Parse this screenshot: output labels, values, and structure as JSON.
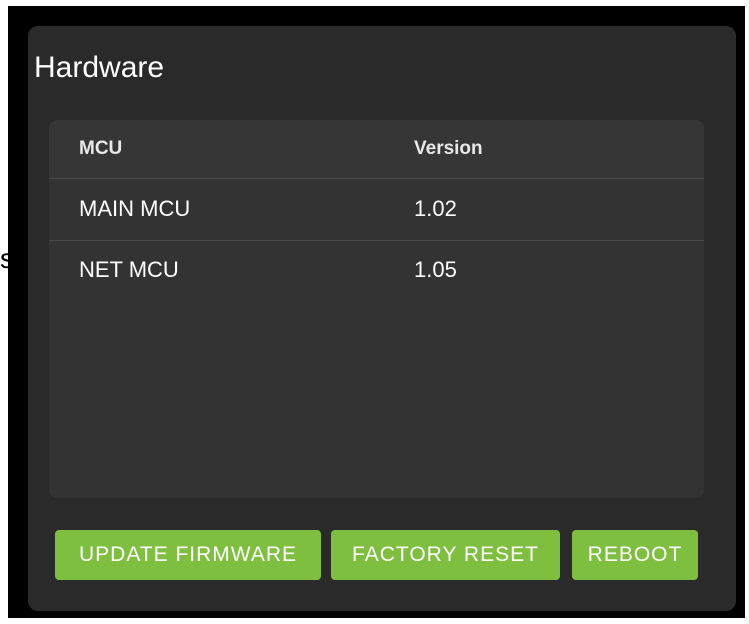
{
  "stray_text": "s",
  "card": {
    "title": "Hardware"
  },
  "table": {
    "columns": [
      "MCU",
      "Version"
    ],
    "rows": [
      [
        "MAIN MCU",
        "1.02"
      ],
      [
        "NET MCU",
        "1.05"
      ]
    ]
  },
  "actions": {
    "update_firmware": "UPDATE FIRMWARE",
    "factory_reset": "FACTORY RESET",
    "reboot": "REBOOT"
  },
  "colors": {
    "card_bg": "#2a2a2a",
    "table_bg": "#333333",
    "button_green": "#7fbf3f",
    "text": "#ffffff"
  }
}
